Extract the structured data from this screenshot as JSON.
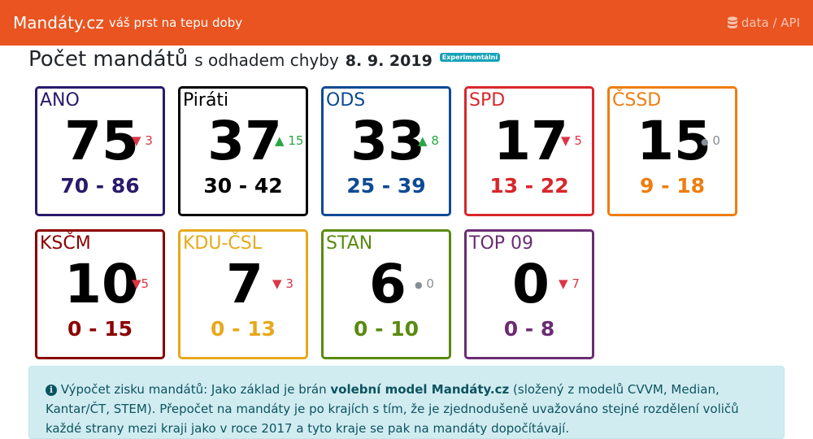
{
  "nav": {
    "brand": "Mandáty.cz",
    "tagline": "váš prst na tepu doby",
    "link_label": "data / API",
    "link_icon": "database-icon"
  },
  "heading": {
    "title": "Počet mandátů",
    "subtitle": "s odhadem chyby",
    "date": "8. 9. 2019",
    "badge": "Experimentální"
  },
  "parties": [
    {
      "name": "ANO",
      "seats": "75",
      "arrow": "▼",
      "change": "3",
      "trend": "down",
      "range": "70 - 86",
      "color": "#2a1a6b"
    },
    {
      "name": "Piráti",
      "seats": "37",
      "arrow": "▲",
      "change": "15",
      "trend": "up",
      "range": "30 - 42",
      "color": "#000000"
    },
    {
      "name": "ODS",
      "seats": "33",
      "arrow": "▲",
      "change": "8",
      "trend": "up",
      "range": "25 - 39",
      "color": "#0d4a94"
    },
    {
      "name": "SPD",
      "seats": "17",
      "arrow": "▼",
      "change": "5",
      "trend": "down",
      "range": "13 - 22",
      "color": "#d9262b"
    },
    {
      "name": "ČSSD",
      "seats": "15",
      "arrow": "●",
      "change": "0",
      "trend": "zero",
      "range": "9 - 18",
      "color": "#ef7d10"
    },
    {
      "name": "KSČM",
      "seats": "10",
      "arrow": "▼",
      "change": "5",
      "trend": "down",
      "range": "0 - 15",
      "color": "#8b0000"
    },
    {
      "name": "KDU-ČSL",
      "seats": "7",
      "arrow": "▼",
      "change": "3",
      "trend": "down",
      "range": "0 - 13",
      "color": "#e6a91c"
    },
    {
      "name": "STAN",
      "seats": "6",
      "arrow": "●",
      "change": "0",
      "trend": "zero",
      "range": "0 - 10",
      "color": "#5a8a0f"
    },
    {
      "name": "TOP 09",
      "seats": "0",
      "arrow": "▼",
      "change": "7",
      "trend": "down",
      "range": "0 - 8",
      "color": "#6b2c73"
    }
  ],
  "alert": {
    "icon": "info-icon",
    "intro": "Výpočet zisku mandátů: Jako základ je brán",
    "model": "volební model Mandáty.cz",
    "rest": "(složený z modelů CVVM, Median, Kantar/ČT, STEM). Přepočet na mandáty je po krajích s tím, že je zjednodušeně uvažováno stejné rozdělení voličů každé strany mezi kraji jako v roce 2017 a tyto kraje se pak na mandáty dopočítávají."
  }
}
